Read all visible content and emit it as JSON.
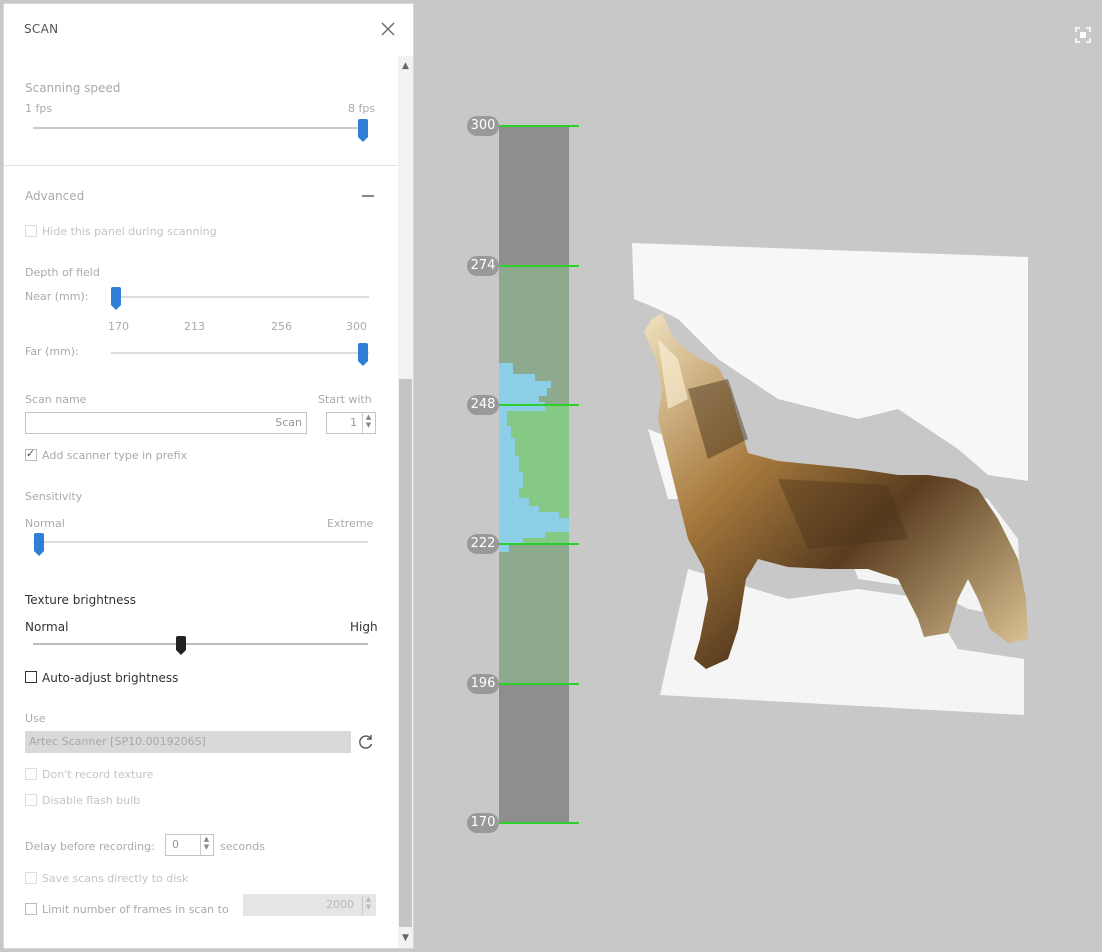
{
  "panel": {
    "title": "SCAN",
    "scanning_speed": {
      "label": "Scanning speed",
      "min_label": "1 fps",
      "max_label": "8 fps",
      "value_fraction": 1.0
    },
    "advanced": {
      "title": "Advanced",
      "hide_panel_label": "Hide this panel during scanning",
      "depth_of_field": {
        "label": "Depth of field",
        "near_label": "Near (mm):",
        "far_label": "Far (mm):",
        "ticks": [
          "170",
          "213",
          "256",
          "300"
        ],
        "near_value_fraction": 0.0,
        "far_value_fraction": 1.0
      },
      "scan_name": {
        "label": "Scan name",
        "value": "Scan",
        "start_with_label": "Start with",
        "start_with_value": "1"
      },
      "add_scanner_type_label": "Add scanner type in prefix",
      "add_scanner_type_checked": true,
      "sensitivity": {
        "label": "Sensitivity",
        "min_label": "Normal",
        "max_label": "Extreme",
        "value_fraction": 0.02
      },
      "texture_brightness": {
        "label": "Texture brightness",
        "min_label": "Normal",
        "max_label": "High",
        "value_fraction": 0.45
      },
      "auto_adjust_label": "Auto-adjust brightness",
      "auto_adjust_checked": false,
      "use": {
        "label": "Use",
        "value": "Artec Scanner [SP10.0019206S]"
      },
      "dont_record_texture_label": "Don't record texture",
      "disable_flash_label": "Disable flash bulb",
      "delay": {
        "label": "Delay before recording:",
        "value": "0",
        "unit": "seconds"
      },
      "save_directly_label": "Save scans directly to disk",
      "limit_frames": {
        "label": "Limit number of frames in scan to",
        "value": "2000"
      }
    }
  },
  "viewport": {
    "depth_ticks": [
      "300",
      "274",
      "248",
      "222",
      "196",
      "170"
    ],
    "colors": {
      "depth_bar": "#8e8e8e",
      "range": "#8eaa8e",
      "band": "#86c986",
      "histogram": "#8ecfe8",
      "tick": "#2bd12b",
      "slider_accent": "#2f7ed8"
    },
    "model_description": "wolf-figure"
  },
  "icons": {
    "close": "close-icon",
    "fullscreen": "fullscreen-icon",
    "refresh": "refresh-icon",
    "collapse": "minus-icon",
    "scroll_up": "chevron-up-icon",
    "scroll_down": "chevron-down-icon"
  }
}
